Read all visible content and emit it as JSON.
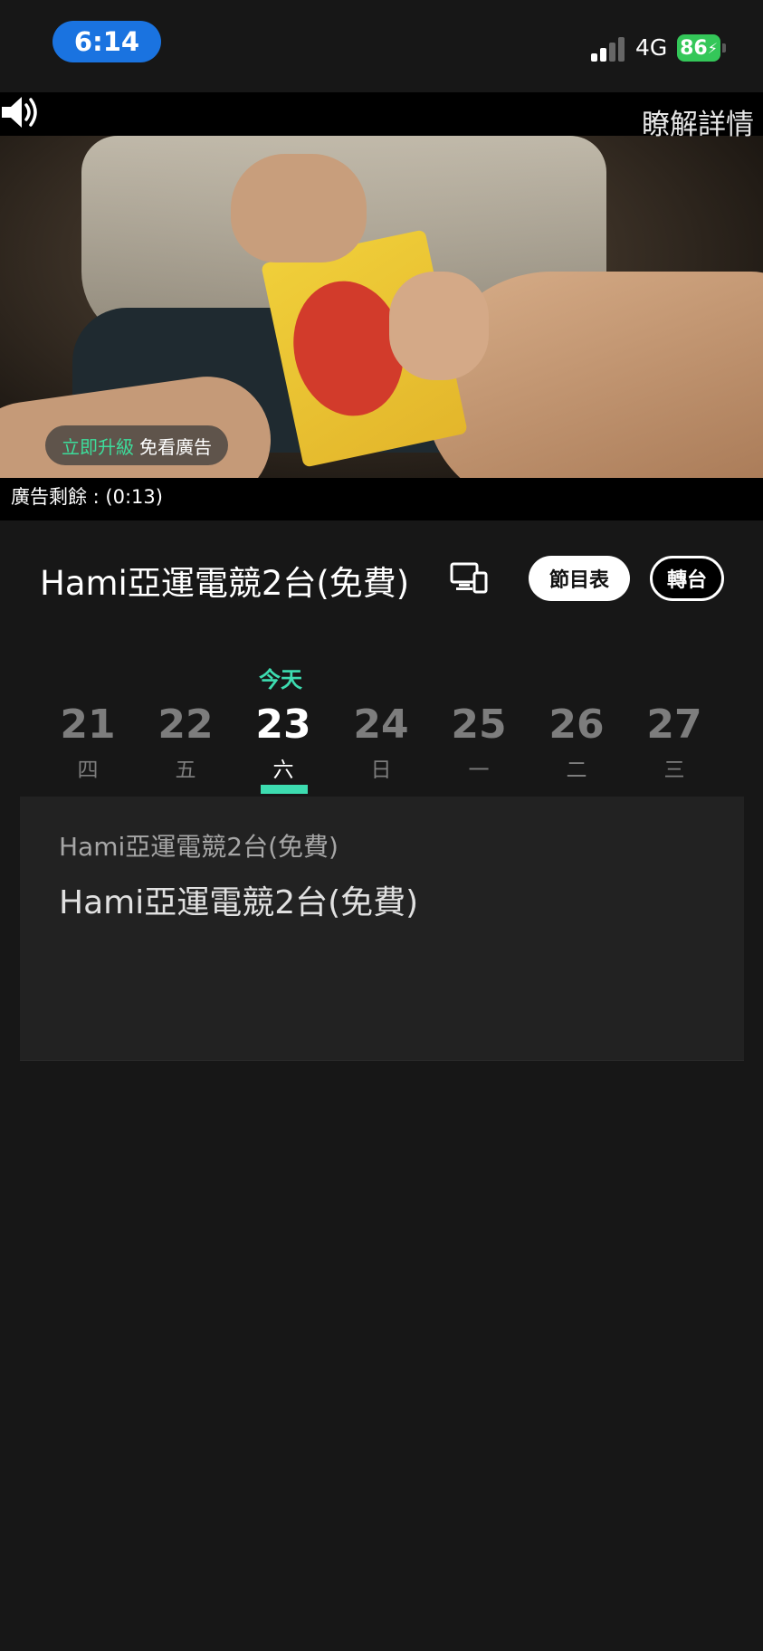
{
  "status_bar": {
    "time": "6:14",
    "network": "4G",
    "battery": "86"
  },
  "player": {
    "learn_more": "瞭解詳情",
    "upgrade_highlight": "立即升級",
    "upgrade_text": "免看廣告",
    "ad_remaining": "廣告剩餘 : (0:13)"
  },
  "channel": {
    "title": "Hami亞運電競2台(免費)",
    "schedule_button": "節目表",
    "switch_button": "轉台"
  },
  "dates": {
    "today_label": "今天",
    "items": [
      {
        "day": "21",
        "weekday": "四"
      },
      {
        "day": "22",
        "weekday": "五"
      },
      {
        "day": "23",
        "weekday": "六"
      },
      {
        "day": "24",
        "weekday": "日"
      },
      {
        "day": "25",
        "weekday": "一"
      },
      {
        "day": "26",
        "weekday": "二"
      },
      {
        "day": "27",
        "weekday": "三"
      }
    ],
    "selected_index": 2
  },
  "program": {
    "subtitle": "Hami亞運電競2台(免費)",
    "title": "Hami亞運電競2台(免費)"
  },
  "colors": {
    "accent": "#3ddcb0",
    "time_pill": "#1a73e0",
    "battery": "#34c759",
    "background": "#171717"
  }
}
